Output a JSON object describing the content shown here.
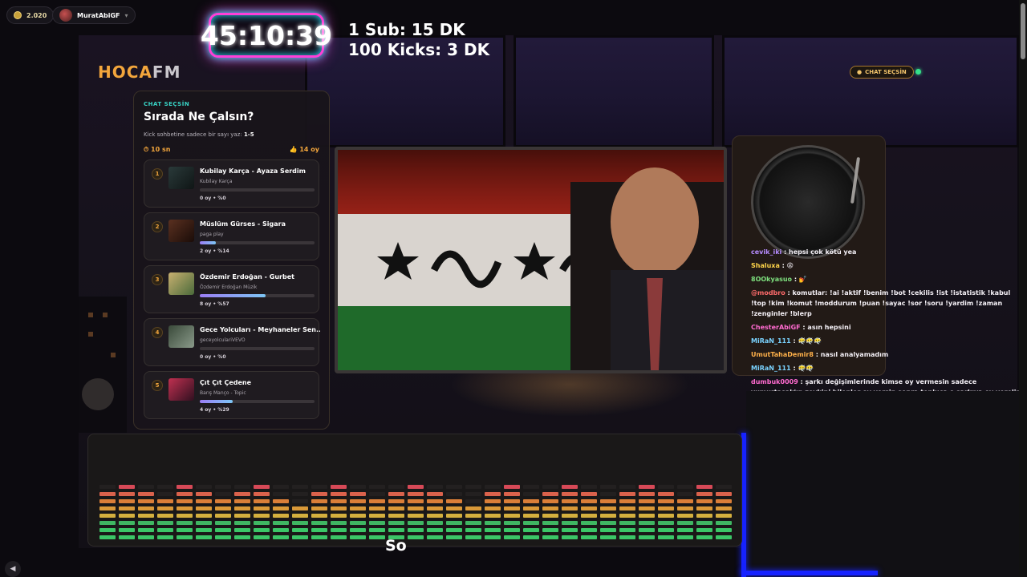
{
  "topbar": {
    "coins": "2.020",
    "username": "MuratAbiGF",
    "dropdown_glyph": "▾"
  },
  "timer": "45:10:39",
  "goals": [
    "1 Sub: 15 DK",
    "100 Kicks: 3 DK"
  ],
  "logo": {
    "part1": "HOCA",
    "part2": "FM"
  },
  "chat_pick_button": "CHAT SEÇSİN",
  "poll": {
    "kicker": "CHAT SEÇSİN",
    "title": "Sırada Ne Çalsın?",
    "hint_prefix": "Kick sohbetine sadece bir sayı yaz: ",
    "hint_range": "1-5",
    "countdown": "10 sn",
    "total_votes": "14 oy",
    "items": [
      {
        "num": "1",
        "title": "Kubilay Karça - Ayaza Serdim",
        "artist": "Kubilay Karça",
        "votes": "0 oy • %0",
        "percent": 0
      },
      {
        "num": "2",
        "title": "Müslüm Gürses - Sigara",
        "artist": "paga play",
        "votes": "2 oy • %14",
        "percent": 14
      },
      {
        "num": "3",
        "title": "Özdemir Erdoğan - Gurbet",
        "artist": "Özdemir Erdoğan Müzik",
        "votes": "8 oy • %57",
        "percent": 57
      },
      {
        "num": "4",
        "title": "Gece Yolcuları - Meyhaneler Sen...",
        "artist": "geceyolculariVEVO",
        "votes": "0 oy • %0",
        "percent": 0
      },
      {
        "num": "5",
        "title": "Çıt Çıt Çedene",
        "artist": "Barış Manço - Topic",
        "votes": "4 oy • %29",
        "percent": 29
      }
    ]
  },
  "chat": [
    {
      "user": "cevik_iki",
      "color": "#b68cff",
      "msg": "hepsi çok kötü yea"
    },
    {
      "user": "Shaluxa",
      "color": "#ffd54a",
      "msg": "😩"
    },
    {
      "user": "8OOkyasuo",
      "color": "#7ee07e",
      "msg": "💅"
    },
    {
      "user": "@modbro",
      "color": "#ff6b6b",
      "msg": "komutlar: !ai !aktif !benim !bot !cekilis !ist !istatistik !kabul !top !kim !komut !moddurum !puan !sayac !sor !soru !yardim !zaman !zenginler !blerp"
    },
    {
      "user": "ChesterAbiGF",
      "color": "#ff6bd0",
      "msg": "asın hepsini"
    },
    {
      "user": "MiRaN_111",
      "color": "#7ad3ff",
      "msg": "😶‍🌫️😶‍🌫️😶‍🌫️"
    },
    {
      "user": "UmutTahaDemir8",
      "color": "#ffb14a",
      "msg": "nasıl analyamadım"
    },
    {
      "user": "MiRaN_111",
      "color": "#7ad3ff",
      "msg": "😶‍🌫️😶‍🌫️"
    },
    {
      "user": "dumbuk0009",
      "color": "#ff6bd0",
      "msg": "şarkı değişimlerinde kimse oy vermesin sadece yumurtaşak'ın zevkini bilenler oy versin sonra topluca o şarkıya oy verelim"
    }
  ],
  "scroll_text": "So",
  "icons": {
    "coin": "coin-icon",
    "volume": "volume-icon",
    "timer": "clock-icon",
    "votes": "thumbs-up-icon"
  },
  "colors": {
    "accent_orange": "#f3a63c",
    "accent_teal": "#38d6c7",
    "timer_border": "#ff3fd8",
    "timer_glow": "#29e2ff"
  }
}
